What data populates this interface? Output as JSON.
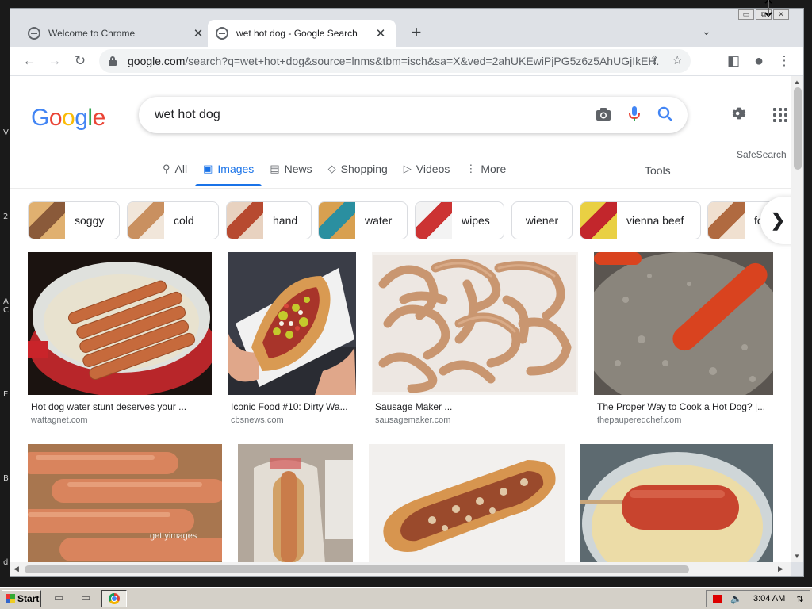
{
  "desktop": {
    "edge_letters": [
      "V",
      "2",
      "A",
      "C",
      "E",
      "B",
      "d"
    ]
  },
  "window": {
    "controls": [
      "▭",
      "⧉",
      "✕"
    ],
    "tabs": [
      {
        "title": "Welcome to Chrome",
        "close": "✕"
      },
      {
        "title": "wet hot dog - Google Search",
        "close": "✕"
      }
    ],
    "new_tab": "+",
    "tab_search": "⌄"
  },
  "toolbar": {
    "back": "←",
    "forward": "→",
    "reload": "↻",
    "url_host": "google.com",
    "url_path": "/search?q=wet+hot+dog&source=lnms&tbm=isch&sa=X&ved=2ahUKEwiPjPG5z6z5AhUGjIkEH...",
    "share": "⇪",
    "star": "☆",
    "sidepanel": "◧",
    "profile": "●",
    "menu": "⋮"
  },
  "google": {
    "logo": [
      "G",
      "o",
      "o",
      "g",
      "l",
      "e"
    ],
    "logo_colors": [
      "#4285f4",
      "#ea4335",
      "#fbbc05",
      "#4285f4",
      "#34a853",
      "#ea4335"
    ],
    "query": "wet hot dog",
    "safesearch": "SafeSearch",
    "tools": "Tools",
    "nav": [
      {
        "label": "All",
        "icon": "search-icon",
        "glyph": "⚲",
        "active": false
      },
      {
        "label": "Images",
        "icon": "image-icon",
        "glyph": "▣",
        "active": true
      },
      {
        "label": "News",
        "icon": "news-icon",
        "glyph": "▤",
        "active": false
      },
      {
        "label": "Shopping",
        "icon": "tag-icon",
        "glyph": "◇",
        "active": false
      },
      {
        "label": "Videos",
        "icon": "play-icon",
        "glyph": "▷",
        "active": false
      },
      {
        "label": "More",
        "icon": "more-icon",
        "glyph": "⋮",
        "active": false
      }
    ],
    "chips": [
      "soggy",
      "cold",
      "hand",
      "water",
      "wipes",
      "wiener",
      "vienna beef",
      "foo"
    ],
    "chip_next": "❯",
    "results": [
      {
        "caption": "Hot dog water stunt deserves your ...",
        "source": "wattagnet.com"
      },
      {
        "caption": "Iconic Food #10: Dirty Wa...",
        "source": "cbsnews.com"
      },
      {
        "caption": "Sausage Maker ...",
        "source": "sausagemaker.com"
      },
      {
        "caption": "The Proper Way to Cook a Hot Dog? |...",
        "source": "thepauperedchef.com"
      },
      {
        "caption": "gettyimages",
        "source": ""
      }
    ],
    "watermark": "gettyimages"
  },
  "taskbar": {
    "start": "Start",
    "time": "3:04 AM"
  }
}
